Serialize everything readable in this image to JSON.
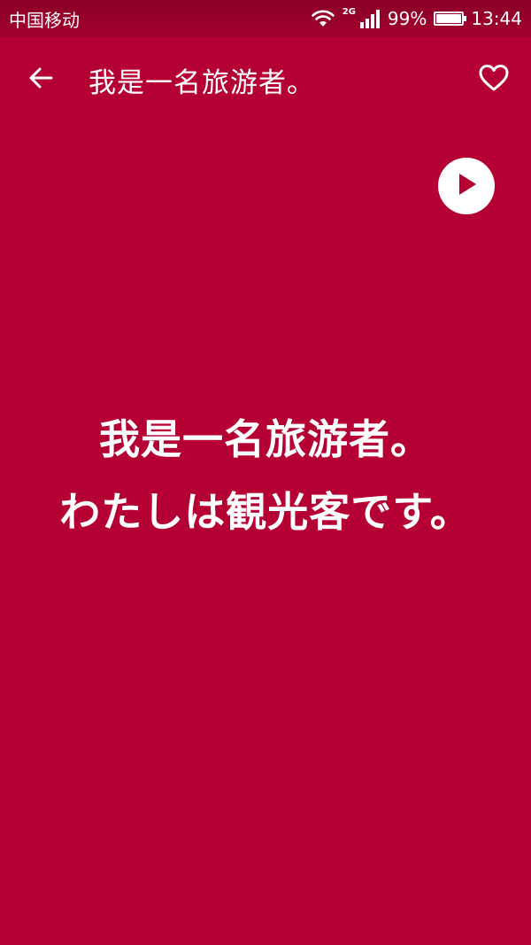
{
  "status_bar": {
    "carrier": "中国移动",
    "network_type": "2G",
    "battery_percent": "99%",
    "battery_level": 0.99,
    "time": "13:44",
    "icons": [
      "wifi-icon",
      "signal-icon",
      "battery-icon"
    ]
  },
  "app_bar": {
    "title": "我是一名旅游者。",
    "back_icon": "arrow-left-icon",
    "favorite_icon": "heart-outline-icon"
  },
  "player": {
    "play_icon": "play-icon"
  },
  "phrase": {
    "chinese": "我是一名旅游者。",
    "japanese": "わたしは観光客です。"
  },
  "colors": {
    "background": "#B50033",
    "text": "#FFFFFF"
  }
}
